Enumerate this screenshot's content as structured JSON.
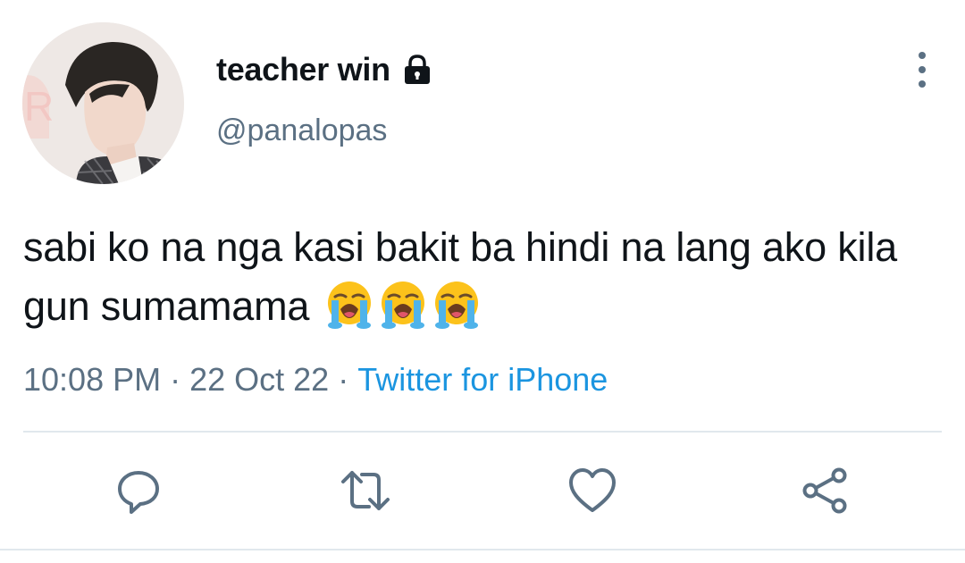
{
  "user": {
    "display_name": "teacher win",
    "handle": "@panalopas",
    "protected_icon": "lock-icon",
    "avatar_icon": "profile-photo"
  },
  "tweet": {
    "text": "sabi ko na nga kasi bakit ba hindi na lang ako kila gun sumamama",
    "emojis": [
      "loudly-crying-face",
      "loudly-crying-face",
      "loudly-crying-face"
    ]
  },
  "meta": {
    "time": "10:08 PM",
    "separator": "·",
    "date": "22 Oct 22",
    "source": "Twitter for iPhone"
  },
  "actions": [
    {
      "name": "reply",
      "icon": "reply-icon"
    },
    {
      "name": "retweet",
      "icon": "retweet-icon"
    },
    {
      "name": "like",
      "icon": "heart-icon"
    },
    {
      "name": "share",
      "icon": "share-icon"
    }
  ],
  "menu": {
    "icon": "more-vertical-icon"
  },
  "colors": {
    "text": "#0f1419",
    "secondary": "#5b7083",
    "link": "#1b95e0",
    "divider": "#e1e8ed"
  }
}
